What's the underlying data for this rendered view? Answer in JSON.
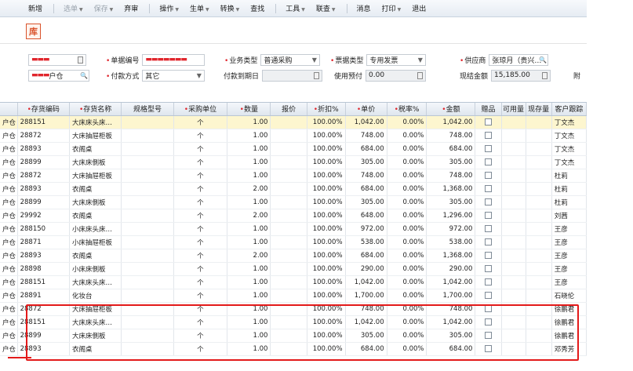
{
  "toolbar": {
    "items": [
      {
        "label": "新增",
        "disabled": false,
        "arrow": false
      },
      {
        "label": "选单",
        "disabled": true,
        "arrow": true
      },
      {
        "label": "保存",
        "disabled": true,
        "arrow": true
      },
      {
        "label": "弃审",
        "disabled": false,
        "arrow": false
      },
      {
        "label": "操作",
        "disabled": false,
        "arrow": true
      },
      {
        "label": "生单",
        "disabled": false,
        "arrow": true
      },
      {
        "label": "转换",
        "disabled": false,
        "arrow": true
      },
      {
        "label": "查找",
        "disabled": false,
        "arrow": false
      },
      {
        "label": "工具",
        "disabled": false,
        "arrow": true
      },
      {
        "label": "联查",
        "disabled": false,
        "arrow": true
      },
      {
        "label": "消息",
        "disabled": false,
        "arrow": false
      },
      {
        "label": "打印",
        "disabled": false,
        "arrow": true
      },
      {
        "label": "退出",
        "disabled": false,
        "arrow": false
      }
    ]
  },
  "title": "库",
  "form": {
    "date_value": "",
    "doc_no_label": "单据编号",
    "doc_no_value": "",
    "biz_type_label": "业务类型",
    "biz_type_value": "普通采购",
    "invoice_type_label": "票据类型",
    "invoice_type_value": "专用发票",
    "supplier_label": "供应商",
    "supplier_value": "张琼月（贵兴…",
    "warehouse_value": "户仓",
    "pay_method_label": "付款方式",
    "pay_method_value": "其它",
    "pay_due_label": "付款到期日",
    "pay_due_value": "",
    "use_prepay_label": "使用预付",
    "use_prepay_value": "0.00",
    "cash_amount_label": "现结金额",
    "cash_amount_value": "15,185.00",
    "attach_label": "附"
  },
  "grid": {
    "columns": [
      {
        "label": "",
        "req": false
      },
      {
        "label": "存货编码",
        "req": true
      },
      {
        "label": "存货名称",
        "req": true
      },
      {
        "label": "规格型号",
        "req": false
      },
      {
        "label": "采购单位",
        "req": true
      },
      {
        "label": "数量",
        "req": true
      },
      {
        "label": "报价",
        "req": false
      },
      {
        "label": "折扣%",
        "req": true
      },
      {
        "label": "单价",
        "req": true
      },
      {
        "label": "税率%",
        "req": true
      },
      {
        "label": "金额",
        "req": true
      },
      {
        "label": "赠品",
        "req": false
      },
      {
        "label": "可用量",
        "req": false
      },
      {
        "label": "现存量",
        "req": false
      },
      {
        "label": "客户跟踪",
        "req": false
      }
    ],
    "rows": [
      [
        "户仓",
        "288151",
        "大床床头床…",
        "",
        "个",
        "1.00",
        "",
        "100.00%",
        "1,042.00",
        "0.00%",
        "1,042.00",
        "",
        "",
        "",
        "丁文杰"
      ],
      [
        "户仓",
        "28872",
        "大床抽屉柜板",
        "",
        "个",
        "1.00",
        "",
        "100.00%",
        "748.00",
        "0.00%",
        "748.00",
        "",
        "",
        "",
        "丁文杰"
      ],
      [
        "户仓",
        "28893",
        "衣阁桌",
        "",
        "个",
        "1.00",
        "",
        "100.00%",
        "684.00",
        "0.00%",
        "684.00",
        "",
        "",
        "",
        "丁文杰"
      ],
      [
        "户仓",
        "28899",
        "大床床側板",
        "",
        "个",
        "1.00",
        "",
        "100.00%",
        "305.00",
        "0.00%",
        "305.00",
        "",
        "",
        "",
        "丁文杰"
      ],
      [
        "户仓",
        "28872",
        "大床抽屉柜板",
        "",
        "个",
        "1.00",
        "",
        "100.00%",
        "748.00",
        "0.00%",
        "748.00",
        "",
        "",
        "",
        "杜莉"
      ],
      [
        "户仓",
        "28893",
        "衣阁桌",
        "",
        "个",
        "2.00",
        "",
        "100.00%",
        "684.00",
        "0.00%",
        "1,368.00",
        "",
        "",
        "",
        "杜莉"
      ],
      [
        "户仓",
        "28899",
        "大床床側板",
        "",
        "个",
        "1.00",
        "",
        "100.00%",
        "305.00",
        "0.00%",
        "305.00",
        "",
        "",
        "",
        "杜莉"
      ],
      [
        "户仓",
        "29992",
        "衣阁桌",
        "",
        "个",
        "2.00",
        "",
        "100.00%",
        "648.00",
        "0.00%",
        "1,296.00",
        "",
        "",
        "",
        "刘茜"
      ],
      [
        "户仓",
        "288150",
        "小床床头床…",
        "",
        "个",
        "1.00",
        "",
        "100.00%",
        "972.00",
        "0.00%",
        "972.00",
        "",
        "",
        "",
        "王彦"
      ],
      [
        "户仓",
        "28871",
        "小床抽屉柜板",
        "",
        "个",
        "1.00",
        "",
        "100.00%",
        "538.00",
        "0.00%",
        "538.00",
        "",
        "",
        "",
        "王彦"
      ],
      [
        "户仓",
        "28893",
        "衣阁桌",
        "",
        "个",
        "2.00",
        "",
        "100.00%",
        "684.00",
        "0.00%",
        "1,368.00",
        "",
        "",
        "",
        "王彦"
      ],
      [
        "户仓",
        "28898",
        "小床床側板",
        "",
        "个",
        "1.00",
        "",
        "100.00%",
        "290.00",
        "0.00%",
        "290.00",
        "",
        "",
        "",
        "王彦"
      ],
      [
        "户仓",
        "288151",
        "大床床头床…",
        "",
        "个",
        "1.00",
        "",
        "100.00%",
        "1,042.00",
        "0.00%",
        "1,042.00",
        "",
        "",
        "",
        "王彦"
      ],
      [
        "户仓",
        "28891",
        "化妆台",
        "",
        "个",
        "1.00",
        "",
        "100.00%",
        "1,700.00",
        "0.00%",
        "1,700.00",
        "",
        "",
        "",
        "石晓伦"
      ],
      [
        "户仓",
        "28872",
        "大床抽屉柜板",
        "",
        "个",
        "1.00",
        "",
        "100.00%",
        "748.00",
        "0.00%",
        "748.00",
        "",
        "",
        "",
        "徐鹏君"
      ],
      [
        "户仓",
        "288151",
        "大床床头床…",
        "",
        "个",
        "1.00",
        "",
        "100.00%",
        "1,042.00",
        "0.00%",
        "1,042.00",
        "",
        "",
        "",
        "徐鹏君"
      ],
      [
        "户仓",
        "28899",
        "大床床側板",
        "",
        "个",
        "1.00",
        "",
        "100.00%",
        "305.00",
        "0.00%",
        "305.00",
        "",
        "",
        "",
        "徐鹏君"
      ],
      [
        "户仓",
        "28893",
        "衣阁桌",
        "",
        "个",
        "1.00",
        "",
        "100.00%",
        "684.00",
        "0.00%",
        "684.00",
        "",
        "",
        "",
        "邓秀芳"
      ]
    ]
  },
  "colors": {
    "highlight": "#e31a1a",
    "selected_row": "#fdf6cf",
    "title_accent": "#d9532c"
  }
}
